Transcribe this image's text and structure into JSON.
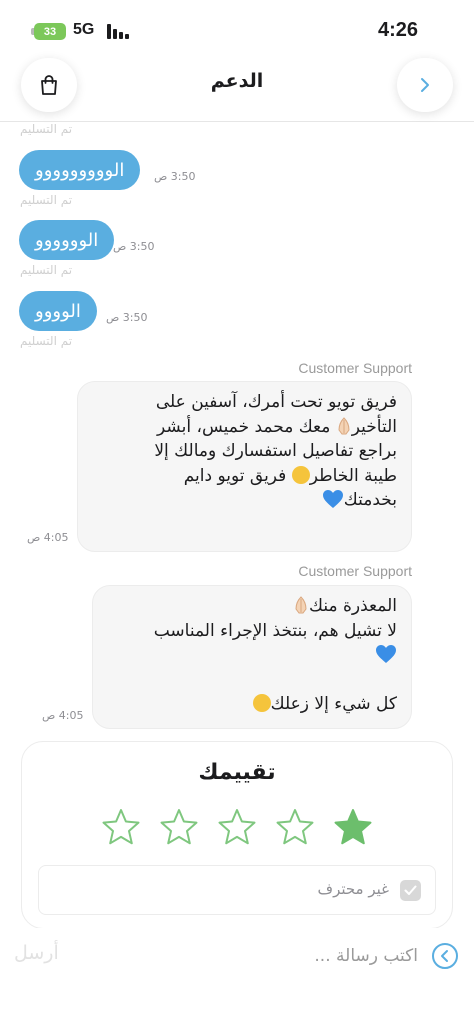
{
  "status_bar": {
    "battery": "33",
    "network": "5G",
    "time": "4:26"
  },
  "header": {
    "title": "الدعم"
  },
  "chat": {
    "delivered_label": "تم التسليم",
    "user_messages": [
      {
        "text": "الووووووووو",
        "time": "3:50 ص"
      },
      {
        "text": "الوووووو",
        "time": "3:50 ص"
      },
      {
        "text": "الوووو",
        "time": "3:50 ص"
      }
    ],
    "agent_messages": [
      {
        "sender": "Customer Support",
        "line1": "فريق تويو تحت أمرك، آسفين على",
        "line2": "التأخير",
        "line2b": " معك محمد خميس، أبشر",
        "line3": "براجع تفاصيل استفسارك ومالك إلا",
        "line4": "طيبة الخاطر",
        "line4b": " فريق تويو دايم",
        "line5": "بخدمتك",
        "time": "4:05 ص"
      },
      {
        "sender": "Customer Support",
        "line1": "المعذرة منك",
        "line2": "لا تشيل هم، بنتخذ الإجراء المناسب",
        "line3": "",
        "line4": "كل شيء إلا زعلك",
        "time": "4:05 ص"
      }
    ]
  },
  "rating": {
    "title": "تقييمك",
    "value": 1,
    "max": 5,
    "filled_color": "#6cbe6c",
    "outline_color": "#7fc77f",
    "checkbox_label": "غير محترف",
    "checkbox_checked": true
  },
  "input": {
    "placeholder": "اكتب رسالة ...",
    "send_label": "أرسل"
  },
  "colors": {
    "accent": "#5aaee0"
  }
}
